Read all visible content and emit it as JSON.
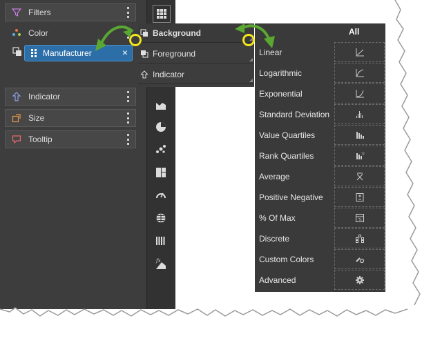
{
  "shelves": {
    "filters": "Filters",
    "color": "Color",
    "indicator": "Indicator",
    "size": "Size",
    "tooltip": "Tooltip"
  },
  "pill": {
    "label": "Manufacturer",
    "remove_glyph": "×"
  },
  "submenu": {
    "background": "Background",
    "foreground": "Foreground",
    "indicator": "Indicator"
  },
  "scales_header": "All",
  "scales": [
    {
      "label": "Linear",
      "icon": "linear-scale-icon"
    },
    {
      "label": "Logarithmic",
      "icon": "log-scale-icon"
    },
    {
      "label": "Exponential",
      "icon": "exponential-scale-icon"
    },
    {
      "label": "Standard Deviation",
      "icon": "std-dev-icon"
    },
    {
      "label": "Value Quartiles",
      "icon": "value-quartiles-icon"
    },
    {
      "label": "Rank Quartiles",
      "icon": "rank-quartiles-icon"
    },
    {
      "label": "Average",
      "icon": "average-icon"
    },
    {
      "label": "Positive Negative",
      "icon": "positive-negative-icon"
    },
    {
      "label": "% Of Max",
      "icon": "percent-max-icon"
    },
    {
      "label": "Discrete",
      "icon": "discrete-icon"
    },
    {
      "label": "Custom Colors",
      "icon": "custom-colors-icon"
    },
    {
      "label": "Advanced",
      "icon": "gear-icon"
    }
  ],
  "toolbar_icons": [
    "grid-icon",
    "area-chart-icon",
    "pie-chart-icon",
    "scatter-icon",
    "treemap-icon",
    "gauge-icon",
    "globe-icon",
    "kpi-icon",
    "formula-chart-icon"
  ],
  "colors": {
    "panel": "#3d3d3d",
    "pill": "#2c6fa8",
    "highlight_ring": "#f2e51b",
    "arrow": "#5aa832"
  }
}
